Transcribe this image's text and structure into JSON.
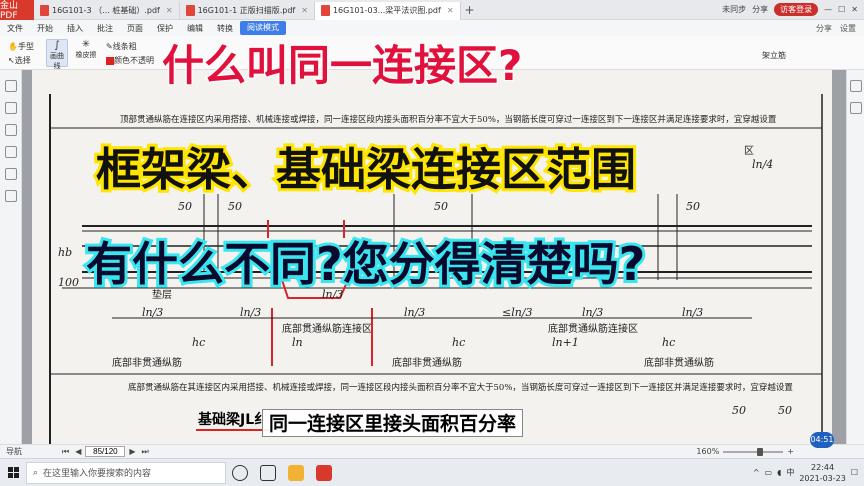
{
  "titlebar": {
    "app_badge": "金山PDF",
    "tabs": [
      {
        "label": "16G101-3 （... 桩基础）.pdf",
        "active": false
      },
      {
        "label": "16G101-1 正版扫描版.pdf",
        "active": false
      },
      {
        "label": "16G101-03...梁平法识图.pdf",
        "active": true
      }
    ],
    "right": {
      "sync": "未同步",
      "share": "分享",
      "login": "访客登录"
    }
  },
  "menubar": {
    "items": [
      "文件",
      "开始",
      "插入",
      "批注",
      "页面",
      "保护",
      "编辑",
      "转换",
      "阅读模式"
    ],
    "active_index": 8,
    "right": [
      "分享",
      "设置"
    ]
  },
  "ribbon": {
    "hand": "手型",
    "select": "选择",
    "draw_curve": "画曲线",
    "eraser": "橡皮擦",
    "line_thickness": "线条粗",
    "color": "颜色",
    "opacity": "不透明",
    "shelf": "架立筋"
  },
  "document": {
    "top_note": "顶部贯通纵筋在连接区内采用搭接、机械连接或焊接，同一连接区段内接头面积百分率不宜大于50%，当钢筋长度可穿过一连接区到下一连接区并满足连接要求时，宜穿越设置",
    "bottom_note": "底部贯通纵筋在其连接区内采用搭接、机械连接或焊接，同一连接区段内接头面积百分率不宜大于50%，当钢筋长度可穿过一连接区到下一连接区并满足连接要求时，宜穿越设置",
    "dim_50": "50",
    "dim_ln3": "ln/3",
    "dim_ln4": "ln/4",
    "dim_le3": "≤ln/3",
    "dim_ln": "ln",
    "dim_ln1": "ln+1",
    "hb": "hb",
    "hc": "hc",
    "h100": "100",
    "floor": "垫层",
    "zone_label": "底部贯通纵筋连接区",
    "non_through": "底部非贯通纵筋",
    "zone_top_right": "区"
  },
  "overlay": {
    "headline_1": "什么叫同一连接区?",
    "headline_2": "框架梁、基础梁连接区范围",
    "headline_3": "有什么不同?您分得清楚吗?",
    "jl_label": "基础梁JL纟",
    "subtitle": "同一连接区里接头面积百分率"
  },
  "statusbar": {
    "nav": "导航",
    "page": "85/120",
    "zoom": "160%",
    "time_badge": "04:51"
  },
  "taskbar": {
    "search_placeholder": "在这里输入你要搜索的内容",
    "time": "22:44",
    "date": "2021-03-23",
    "ime": "中"
  },
  "colors": {
    "accent": "#3f7ee8",
    "headline_red": "#e0123d",
    "headline_yellow_stroke": "#ffe600",
    "headline_cyan_stroke": "#39e6f0"
  }
}
